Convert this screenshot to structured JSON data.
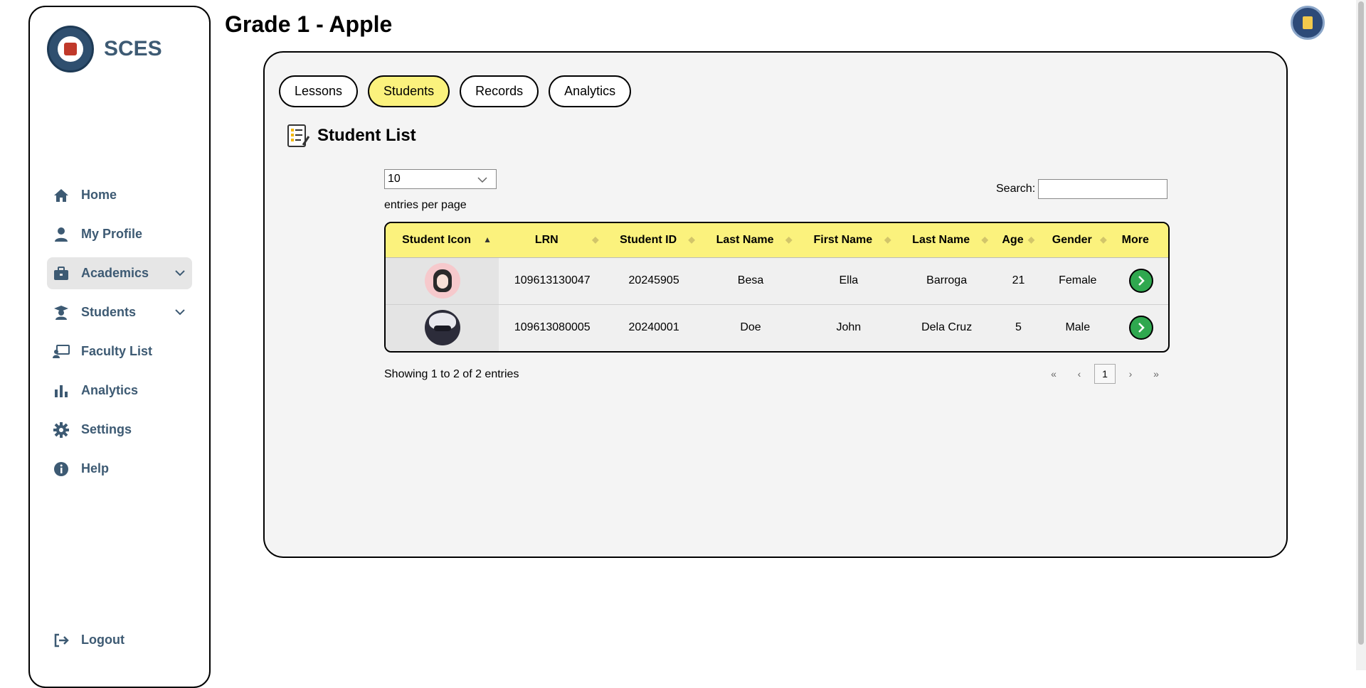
{
  "app": {
    "brand": "SCES",
    "page_title": "Grade 1 - Apple"
  },
  "sidebar": {
    "items": [
      {
        "label": "Home",
        "icon": "home-icon"
      },
      {
        "label": "My Profile",
        "icon": "user-icon"
      },
      {
        "label": "Academics",
        "icon": "briefcase-icon"
      },
      {
        "label": "Students",
        "icon": "graduate-icon"
      },
      {
        "label": "Faculty List",
        "icon": "teacher-board-icon"
      },
      {
        "label": "Analytics",
        "icon": "bar-chart-icon"
      },
      {
        "label": "Settings",
        "icon": "gear-icon"
      },
      {
        "label": "Help",
        "icon": "info-icon"
      }
    ],
    "logout": "Logout"
  },
  "tabs": [
    {
      "label": "Lessons"
    },
    {
      "label": "Students"
    },
    {
      "label": "Records"
    },
    {
      "label": "Analytics"
    }
  ],
  "section": {
    "title": "Student List"
  },
  "controls": {
    "entries_value": "10",
    "entries_label": "entries per page",
    "search_label": "Search:",
    "search_value": ""
  },
  "table": {
    "headers": [
      "Student Icon",
      "LRN",
      "Student ID",
      "Last Name",
      "First Name",
      "Last Name",
      "Age",
      "Gender",
      "More"
    ],
    "rows": [
      {
        "lrn": "109613130047",
        "student_id": "20245905",
        "last_name": "Besa",
        "first_name": "Ella",
        "last_name_2": "Barroga",
        "age": "21",
        "gender": "Female"
      },
      {
        "lrn": "109613080005",
        "student_id": "20240001",
        "last_name": "Doe",
        "first_name": "John",
        "last_name_2": "Dela Cruz",
        "age": "5",
        "gender": "Male"
      }
    ]
  },
  "footer": {
    "info": "Showing 1 to 2 of 2 entries",
    "pager": {
      "first": "«",
      "prev": "‹",
      "current": "1",
      "next": "›",
      "last": "»"
    }
  },
  "colors": {
    "accent": "#fbf27d",
    "nav_text": "#3d5a73",
    "more_button": "#2fa84f"
  }
}
